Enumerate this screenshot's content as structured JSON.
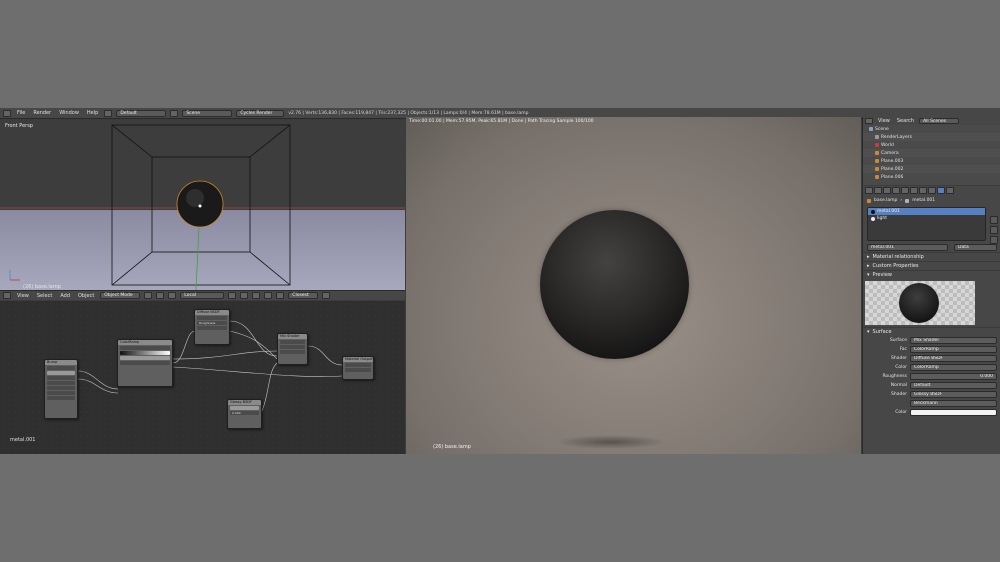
{
  "topbar": {
    "menus": [
      "File",
      "Render",
      "Window",
      "Help"
    ],
    "layout": "Default",
    "scene": "Scene",
    "engine": "Cycles Render",
    "stats": "v2.76 | Verts:136,830 | Faces:119,847 | Tris:237,325 | Objects:1/13 | Lamps:0/4 | Mem:78.61M | base.lamp"
  },
  "view3d": {
    "view_label": "Front Persp",
    "object_label": "(26) base.lamp",
    "header": {
      "menus": [
        "View",
        "Select",
        "Add",
        "Object"
      ],
      "mode": "Object Mode",
      "orientation": "Local",
      "snap": "Closest"
    }
  },
  "nodes": {
    "material_name": "metal.001",
    "node_titles": [
      "Diffuse BSDF",
      "ColorRamp",
      "Mix Shader",
      "Material Output",
      "Glossy BSDF",
      "Bump",
      "Roughness",
      "0.000"
    ]
  },
  "render": {
    "info": "Time:00:01.00 | Mem:57.95M, Peak:65.81M | Done | Path Tracing Sample 100/100",
    "object_label": "(26) base.lamp"
  },
  "outliner": {
    "view": "View",
    "search": "Search",
    "filter": "All Scenes",
    "items": [
      "Scene",
      "RenderLayers",
      "World",
      "Camera",
      "Plane.003",
      "Plane.002",
      "Plane.006"
    ]
  },
  "properties": {
    "breadcrumb": [
      "base.lamp",
      "metal.001"
    ],
    "slots": [
      "metal.001",
      "light"
    ],
    "material_field": "metal.001",
    "data_select": "Data",
    "sections": [
      "Material relationship",
      "Custom Properties",
      "Preview",
      "Surface"
    ],
    "surface": [
      {
        "label": "Surface",
        "value": "Mix Shader"
      },
      {
        "label": "Fac",
        "value": "ColorRamp"
      },
      {
        "label": "Shader",
        "value": "Diffuse BSDF"
      },
      {
        "label": "Color",
        "value": "ColorRamp"
      },
      {
        "label": "Roughness",
        "value": "0.000"
      },
      {
        "label": "Normal",
        "value": "Default"
      },
      {
        "label": "Shader",
        "value": "Glossy BSDF"
      },
      {
        "label": "",
        "value": "Beckmann"
      },
      {
        "label": "Color",
        "value": ""
      }
    ]
  }
}
